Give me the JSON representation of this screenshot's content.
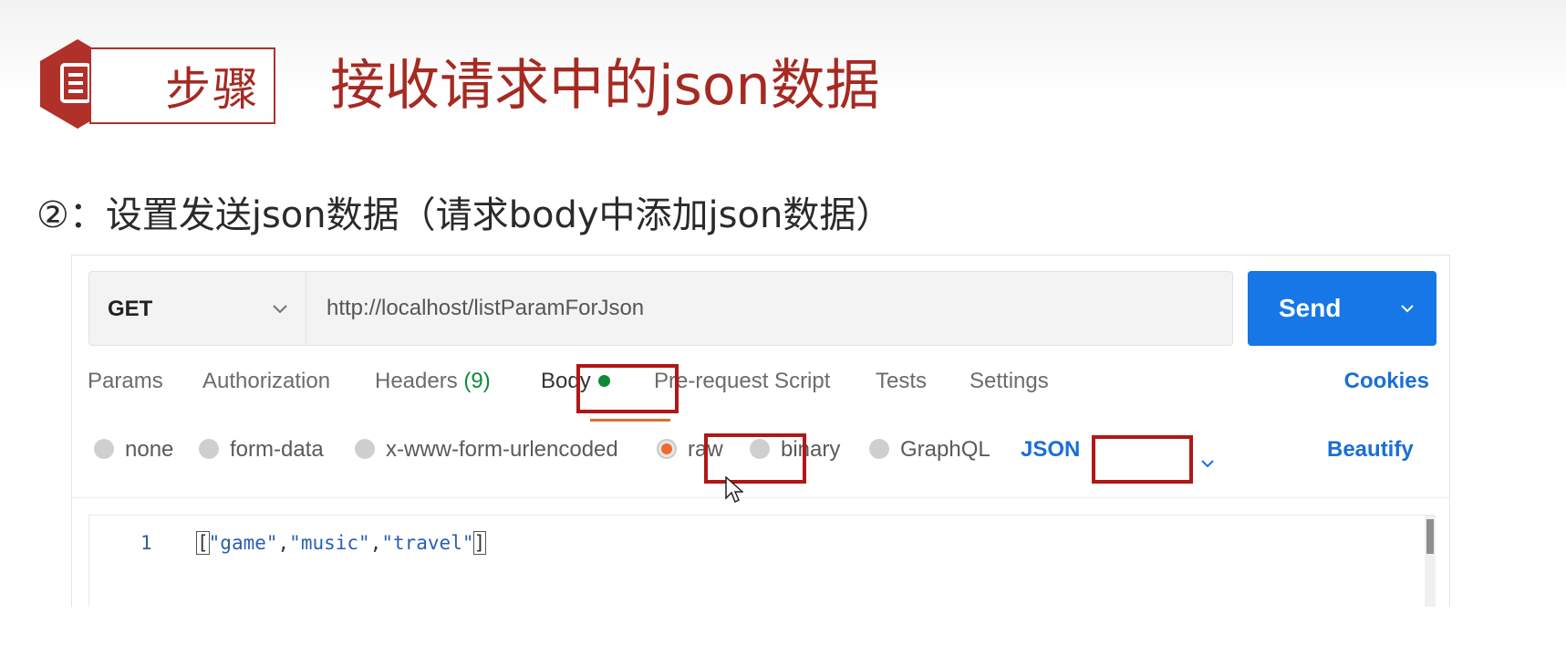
{
  "header": {
    "step_label": "步骤",
    "title": "接收请求中的json数据",
    "badge_icon": "document-icon",
    "accent_color": "#a52a22"
  },
  "subtitle": "②：设置发送json数据（请求body中添加json数据）",
  "request": {
    "method": "GET",
    "url": "http://localhost/listParamForJson",
    "send_label": "Send",
    "send_color": "#1777e6"
  },
  "tabs": [
    {
      "label": "Params"
    },
    {
      "label": "Authorization"
    },
    {
      "label": "Headers",
      "count": "(9)"
    },
    {
      "label": "Body",
      "active": true
    },
    {
      "label": "Pre-request Script"
    },
    {
      "label": "Tests"
    },
    {
      "label": "Settings"
    }
  ],
  "cookies_label": "Cookies",
  "body_types": [
    {
      "label": "none",
      "selected": false
    },
    {
      "label": "form-data",
      "selected": false
    },
    {
      "label": "x-www-form-urlencoded",
      "selected": false
    },
    {
      "label": "raw",
      "selected": true
    },
    {
      "label": "binary",
      "selected": false
    },
    {
      "label": "GraphQL",
      "selected": false
    }
  ],
  "raw_format": "JSON",
  "beautify_label": "Beautify",
  "editor": {
    "line_number": "1",
    "open_bracket": "[",
    "s1": "\"game\"",
    "comma1": ",",
    "s2": "\"music\"",
    "comma2": ",",
    "s3": "\"travel\"",
    "close_bracket": "]"
  },
  "highlight_color": "#b01818"
}
